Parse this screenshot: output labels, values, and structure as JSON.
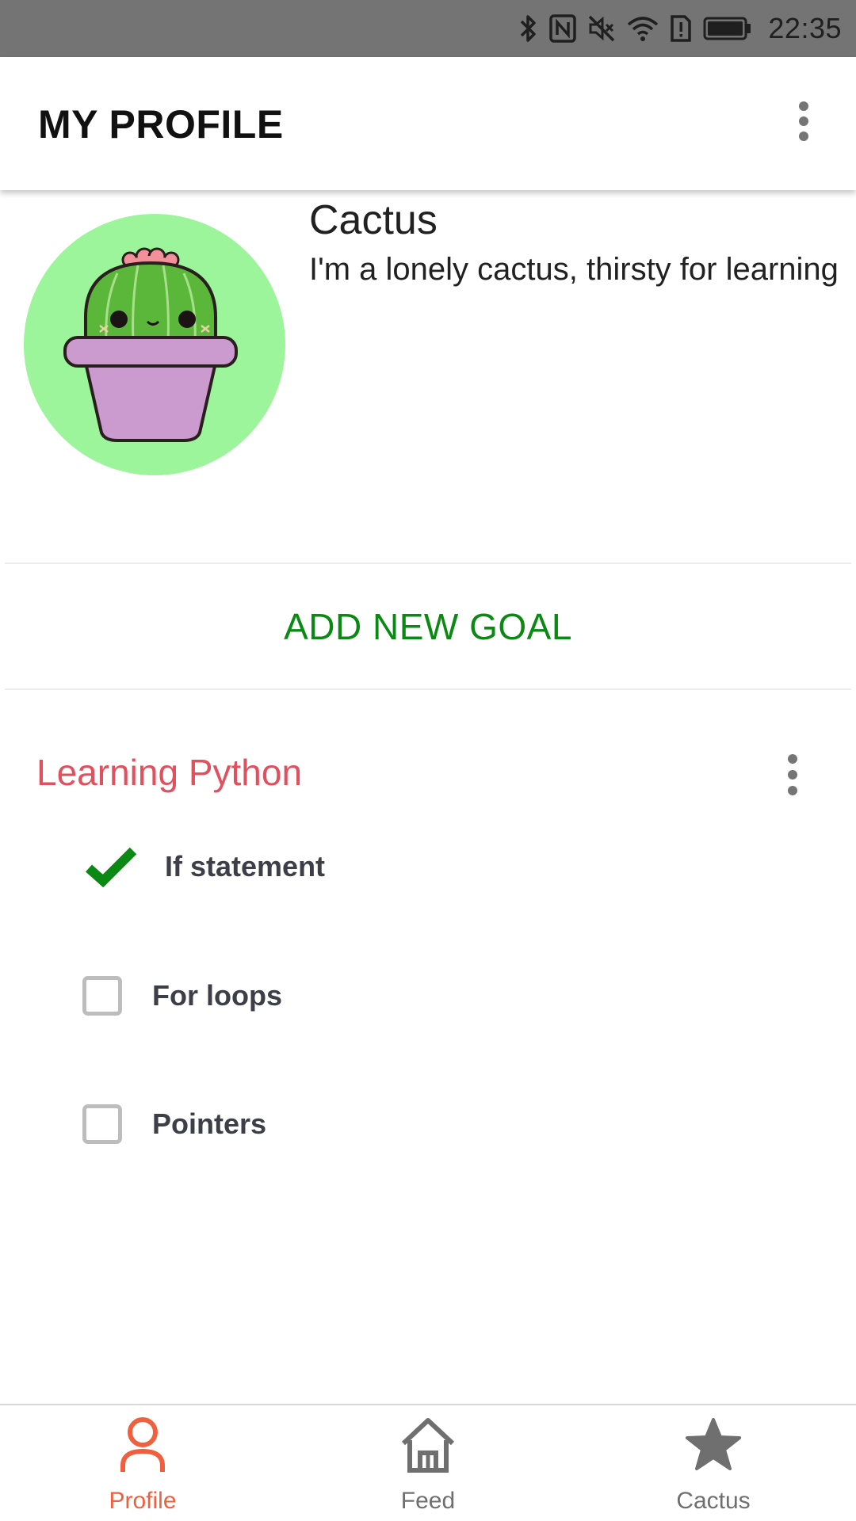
{
  "status_bar": {
    "time": "22:35",
    "icons": [
      "bluetooth-icon",
      "nfc-icon",
      "mute-icon",
      "wifi-icon",
      "sim-alert-icon",
      "battery-icon"
    ]
  },
  "app_bar": {
    "title": "MY PROFILE",
    "menu_icon": "more-vert-icon"
  },
  "profile": {
    "name": "Cactus",
    "bio": "I'm a lonely cactus, thirsty for learning",
    "avatar": "cactus-avatar"
  },
  "actions": {
    "add_goal_label": "ADD NEW GOAL"
  },
  "goal": {
    "title": "Learning Python",
    "tasks": [
      {
        "label": "If statement",
        "done": true
      },
      {
        "label": "For loops",
        "done": false
      },
      {
        "label": "Pointers",
        "done": false
      }
    ]
  },
  "bottom_nav": {
    "items": [
      {
        "label": "Profile",
        "icon": "person-icon",
        "active": true
      },
      {
        "label": "Feed",
        "icon": "home-icon",
        "active": false
      },
      {
        "label": "Cactus",
        "icon": "star-icon",
        "active": false
      }
    ]
  },
  "colors": {
    "accent_green": "#0a8a12",
    "goal_title": "#e0505e",
    "nav_active": "#f0603e",
    "avatar_bg": "#9cf59a",
    "status_bar": "#747474"
  }
}
